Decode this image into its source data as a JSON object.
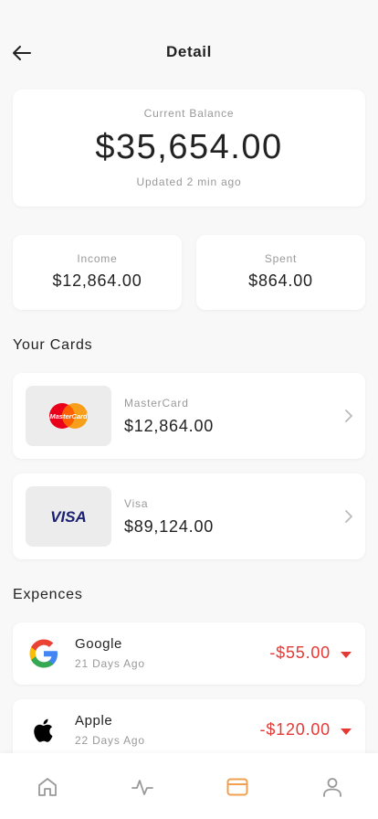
{
  "header": {
    "title": "Detail"
  },
  "balance": {
    "label": "Current Balance",
    "value": "$35,654.00",
    "updated": "Updated 2 min ago"
  },
  "stats": {
    "income": {
      "label": "Income",
      "value": "$12,864.00"
    },
    "spent": {
      "label": "Spent",
      "value": "$864.00"
    }
  },
  "cards_section": {
    "title": "Your Cards",
    "items": [
      {
        "name": "MasterCard",
        "amount": "$12,864.00",
        "logo_text": "MasterCard",
        "icon": "mastercard-logo"
      },
      {
        "name": "Visa",
        "amount": "$89,124.00",
        "logo_text": "VISA",
        "icon": "visa-logo"
      }
    ]
  },
  "expenses_section": {
    "title": "Expences",
    "items": [
      {
        "name": "Google",
        "date": "21 Days Ago",
        "amount": "-$55.00",
        "icon": "google-logo"
      },
      {
        "name": "Apple",
        "date": "22 Days Ago",
        "amount": "-$120.00",
        "icon": "apple-logo"
      }
    ]
  },
  "tabbar": {
    "items": [
      {
        "icon": "home-icon",
        "active": false
      },
      {
        "icon": "activity-icon",
        "active": false
      },
      {
        "icon": "card-icon",
        "active": true
      },
      {
        "icon": "user-icon",
        "active": false
      }
    ]
  },
  "colors": {
    "accent": "#f0a050",
    "negative": "#e53935",
    "visa_blue": "#1a1f71",
    "mastercard_red": "#eb001b",
    "mastercard_orange": "#f79e1b"
  }
}
